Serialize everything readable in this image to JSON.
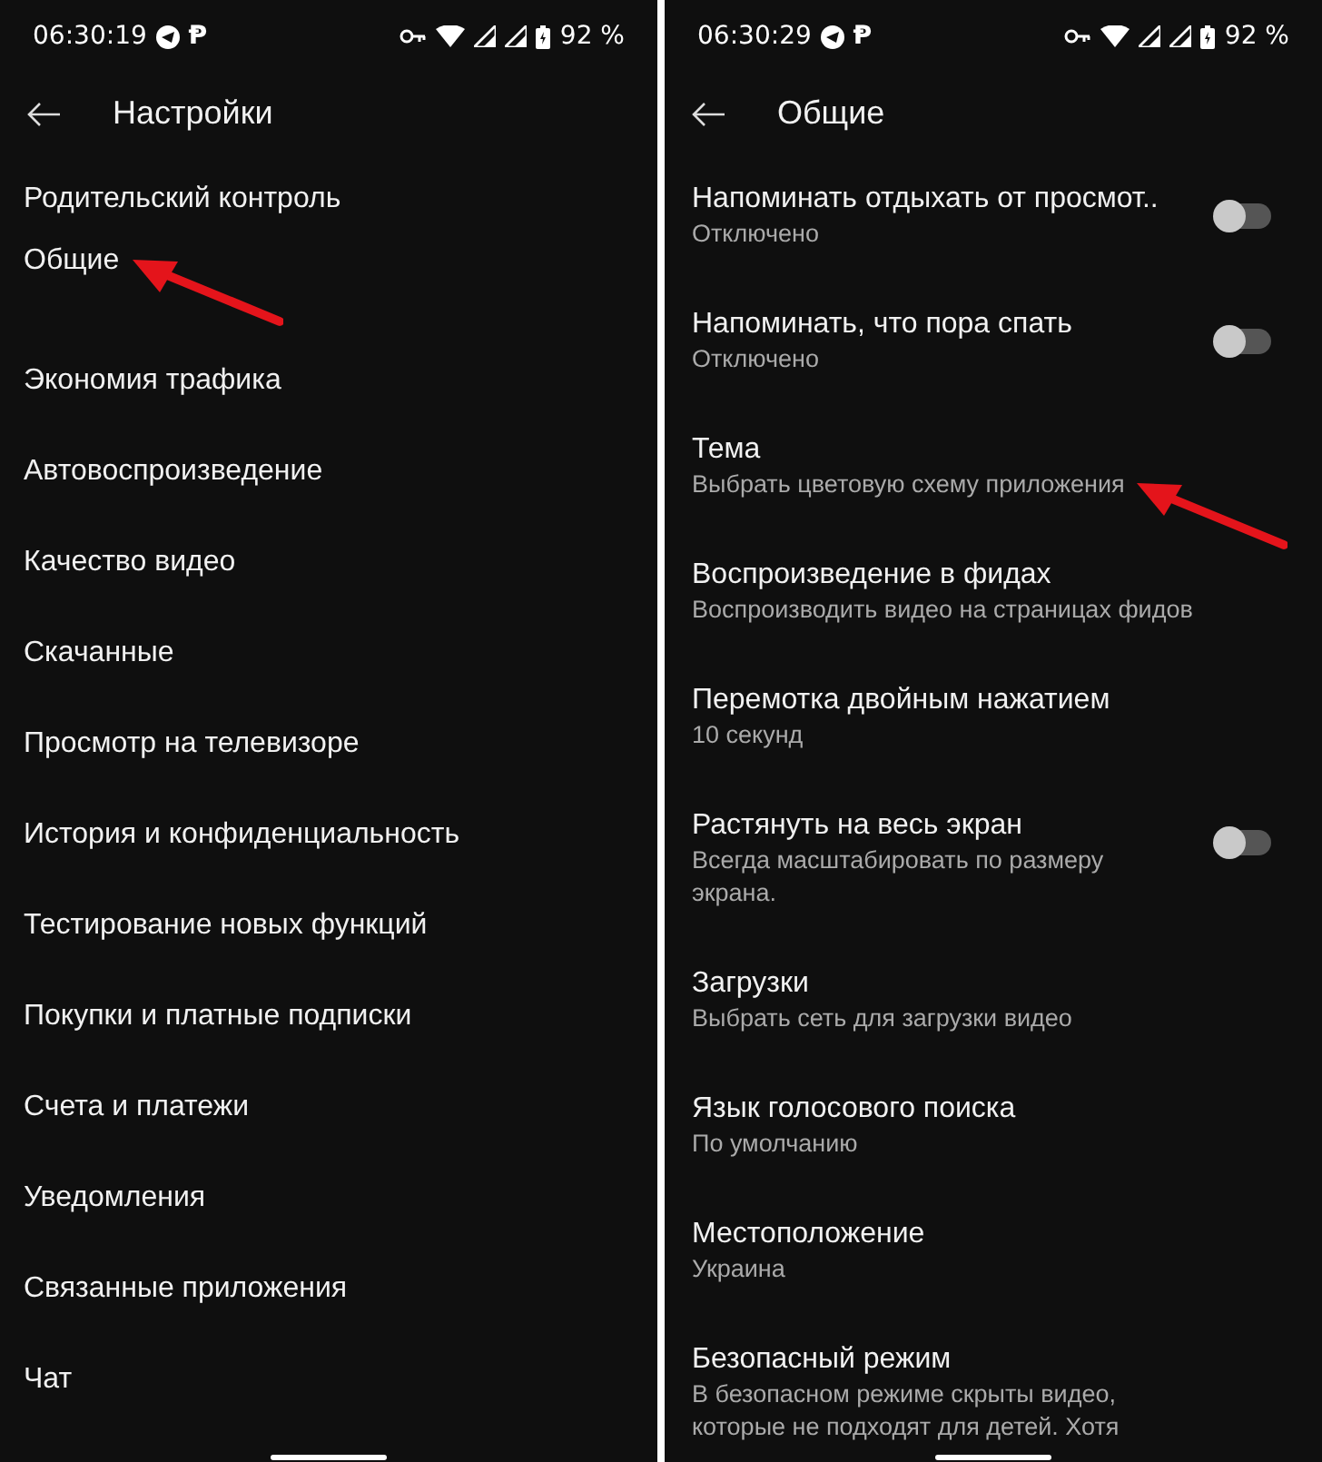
{
  "screens": [
    {
      "kind": "menu",
      "status_bar": {
        "time": "06:30:19",
        "app_glyph": "Ᵽ",
        "battery": "92 %"
      },
      "title": "Настройки",
      "items": [
        {
          "title": "Родительский контроль",
          "pointed": false
        },
        {
          "title": "Общие",
          "pointed": true
        },
        {
          "title": "Экономия трафика",
          "pointed": false
        },
        {
          "title": "Автовоспроизведение",
          "pointed": false
        },
        {
          "title": "Качество видео",
          "pointed": false
        },
        {
          "title": "Скачанные",
          "pointed": false
        },
        {
          "title": "Просмотр на телевизоре",
          "pointed": false
        },
        {
          "title": "История и конфиденциальность",
          "pointed": false
        },
        {
          "title": "Тестирование новых функций",
          "pointed": false
        },
        {
          "title": "Покупки и платные подписки",
          "pointed": false
        },
        {
          "title": "Счета и платежи",
          "pointed": false
        },
        {
          "title": "Уведомления",
          "pointed": false
        },
        {
          "title": "Связанные приложения",
          "pointed": false
        },
        {
          "title": "Чат",
          "pointed": false
        }
      ]
    },
    {
      "kind": "detail",
      "status_bar": {
        "time": "06:30:29",
        "app_glyph": "Ᵽ",
        "battery": "92 %"
      },
      "title": "Общие",
      "items": [
        {
          "kind": "toggle",
          "title": "Напоминать отдыхать от просмот..",
          "subtitle": "Отключено",
          "on": false,
          "pointed": false
        },
        {
          "kind": "toggle",
          "title": "Напоминать, что пора спать",
          "subtitle": "Отключено",
          "on": false,
          "pointed": false
        },
        {
          "kind": "plain",
          "title": "Тема",
          "subtitle": "Выбрать цветовую схему приложения",
          "pointed": true
        },
        {
          "kind": "plain",
          "title": "Воспроизведение в фидах",
          "subtitle": "Воспроизводить видео на страницах фидов",
          "pointed": false
        },
        {
          "kind": "plain",
          "title": "Перемотка двойным нажатием",
          "subtitle": "10 секунд",
          "pointed": false
        },
        {
          "kind": "toggle",
          "title": "Растянуть на весь экран",
          "subtitle": "Всегда масштабировать по размеру экрана.",
          "on": false,
          "pointed": false
        },
        {
          "kind": "plain",
          "title": "Загрузки",
          "subtitle": "Выбрать сеть для загрузки видео",
          "pointed": false
        },
        {
          "kind": "plain",
          "title": "Язык голосового поиска",
          "subtitle": "По умолчанию",
          "pointed": false
        },
        {
          "kind": "plain",
          "title": "Местоположение",
          "subtitle": "Украина",
          "pointed": false
        },
        {
          "kind": "plain",
          "title": "Безопасный режим",
          "subtitle": "В безопасном режиме скрыты видео, которые не подходят для детей. Хотя",
          "pointed": false
        }
      ]
    }
  ]
}
